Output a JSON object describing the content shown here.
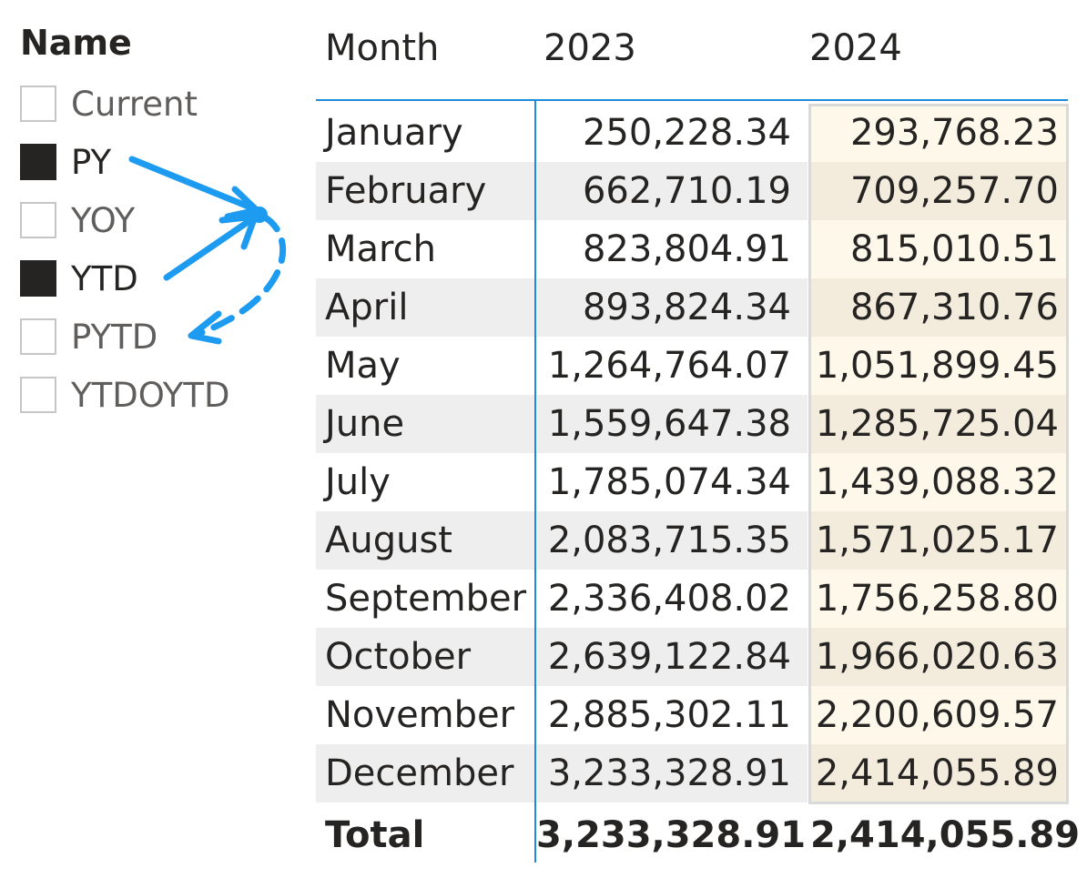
{
  "slicer": {
    "title": "Name",
    "items": [
      {
        "label": "Current",
        "checked": false
      },
      {
        "label": "PY",
        "checked": true
      },
      {
        "label": "YOY",
        "checked": false
      },
      {
        "label": "YTD",
        "checked": true
      },
      {
        "label": "PYTD",
        "checked": false
      },
      {
        "label": "YTDOYTD",
        "checked": false
      }
    ]
  },
  "annotation": {
    "arrow_color": "#1d9bf0"
  },
  "matrix": {
    "headers": {
      "month": "Month",
      "y2023": "2023",
      "y2024": "2024"
    },
    "rows": [
      {
        "month": "January",
        "y2023": "250,228.34",
        "y2024": "293,768.23"
      },
      {
        "month": "February",
        "y2023": "662,710.19",
        "y2024": "709,257.70"
      },
      {
        "month": "March",
        "y2023": "823,804.91",
        "y2024": "815,010.51"
      },
      {
        "month": "April",
        "y2023": "893,824.34",
        "y2024": "867,310.76"
      },
      {
        "month": "May",
        "y2023": "1,264,764.07",
        "y2024": "1,051,899.45"
      },
      {
        "month": "June",
        "y2023": "1,559,647.38",
        "y2024": "1,285,725.04"
      },
      {
        "month": "July",
        "y2023": "1,785,074.34",
        "y2024": "1,439,088.32"
      },
      {
        "month": "August",
        "y2023": "2,083,715.35",
        "y2024": "1,571,025.17"
      },
      {
        "month": "September",
        "y2023": "2,336,408.02",
        "y2024": "1,756,258.80"
      },
      {
        "month": "October",
        "y2023": "2,639,122.84",
        "y2024": "1,966,020.63"
      },
      {
        "month": "November",
        "y2023": "2,885,302.11",
        "y2024": "2,200,609.57"
      },
      {
        "month": "December",
        "y2023": "3,233,328.91",
        "y2024": "2,414,055.89"
      }
    ],
    "total": {
      "label": "Total",
      "y2023": "3,233,328.91",
      "y2024": "2,414,055.89"
    },
    "colors": {
      "accent": "#1d8bd8",
      "band": "#eeeeee",
      "highlight": "#fdf8ea"
    }
  }
}
